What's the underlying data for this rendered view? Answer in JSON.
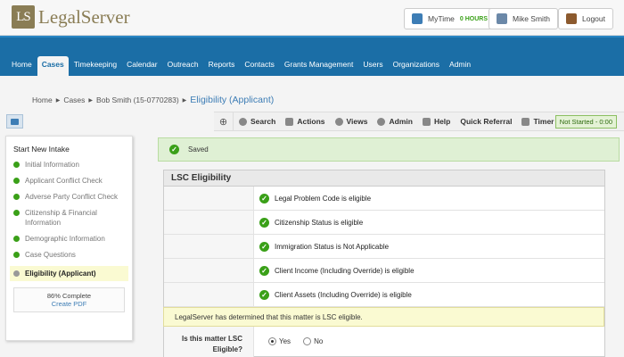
{
  "header": {
    "logo_mark": "LS",
    "logo_text": "LegalServer",
    "mytime_label": "MyTime",
    "mytime_hours": "0 HOURS",
    "user_name": "Mike Smith",
    "logout_label": "Logout"
  },
  "nav": {
    "items": [
      {
        "label": "Home"
      },
      {
        "label": "Cases"
      },
      {
        "label": "Timekeeping"
      },
      {
        "label": "Calendar"
      },
      {
        "label": "Outreach"
      },
      {
        "label": "Reports"
      },
      {
        "label": "Contacts"
      },
      {
        "label": "Grants Management"
      },
      {
        "label": "Users"
      },
      {
        "label": "Organizations"
      },
      {
        "label": "Admin"
      }
    ],
    "active": "Cases"
  },
  "breadcrumb": {
    "items": [
      "Home",
      "Cases",
      "Bob Smith (15-0770283)"
    ],
    "current": "Eligibility (Applicant)"
  },
  "toolbar": {
    "plus": "⊕",
    "items": [
      "Search",
      "Actions",
      "Views",
      "Admin",
      "Help",
      "Quick Referral",
      "Timer"
    ],
    "status": "Not Started - 0:00"
  },
  "sidebar": {
    "title": "Start New Intake",
    "steps": [
      {
        "label": "Initial Information",
        "done": true
      },
      {
        "label": "Applicant Conflict Check",
        "done": true
      },
      {
        "label": "Adverse Party Conflict Check",
        "done": true
      },
      {
        "label": "Citizenship & Financial Information",
        "done": true
      },
      {
        "label": "Demographic Information",
        "done": true
      },
      {
        "label": "Case Questions",
        "done": true
      },
      {
        "label": "Eligibility (Applicant)",
        "done": false,
        "current": true
      }
    ],
    "progress_text": "86% Complete",
    "progress_value": 86,
    "create_pdf": "Create PDF"
  },
  "main": {
    "saved_message": "Saved",
    "panel_title": "LSC Eligibility",
    "checks": [
      "Legal Problem Code is eligible",
      "Citizenship Status is eligible",
      "Immigration Status is Not Applicable",
      "Client Income (Including Override) is eligible",
      "Client Assets (Including Override) is eligible"
    ],
    "notice": "LegalServer has determined that this matter is LSC eligible.",
    "question_label": "Is this matter LSC Eligible?",
    "options": [
      {
        "label": "Yes",
        "selected": true
      },
      {
        "label": "No",
        "selected": false
      }
    ]
  },
  "colors": {
    "nav_bg": "#1b6ea6",
    "logo": "#8a7d55",
    "success": "#3aa018",
    "link": "#3d7db5"
  }
}
